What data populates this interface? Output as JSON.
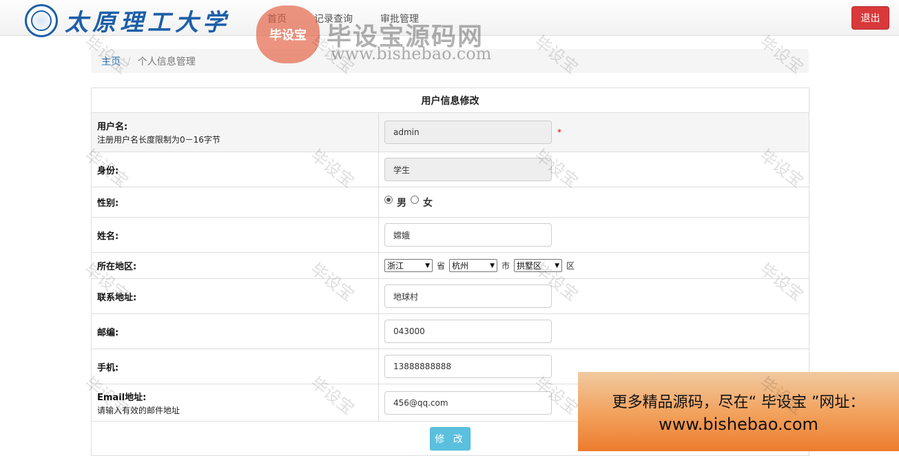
{
  "header": {
    "logo_text": "太原理工大学",
    "nav": [
      "首页",
      "记录查询",
      "审批管理"
    ],
    "logout": "退出"
  },
  "breadcrumb": {
    "home": "主页",
    "current": "个人信息管理"
  },
  "form": {
    "title": "用户信息修改",
    "username": {
      "label": "用户名:",
      "hint": "注册用户名长度限制为0－16字节",
      "value": "admin",
      "required": "*"
    },
    "identity": {
      "label": "身份:",
      "value": "学生"
    },
    "gender": {
      "label": "性别:",
      "options": [
        "男",
        "女"
      ],
      "selected": "男"
    },
    "name": {
      "label": "姓名:",
      "value": "嫦娥"
    },
    "region": {
      "label": "所在地区:",
      "province": "浙江",
      "province_unit": "省",
      "city": "杭州",
      "city_unit": "市",
      "district": "拱墅区",
      "district_unit": "区"
    },
    "address": {
      "label": "联系地址:",
      "value": "地球村"
    },
    "zip": {
      "label": "邮编:",
      "value": "043000"
    },
    "phone": {
      "label": "手机:",
      "value": "13888888888"
    },
    "email": {
      "label": "Email地址:",
      "hint": "请输入有效的邮件地址",
      "value": "456@qq.com"
    },
    "submit": "修 改"
  },
  "watermark": {
    "text": "毕设宝",
    "brand": "毕设宝源码网",
    "url": "www.bishebao.com"
  },
  "promo": {
    "line1": "更多精品源码，尽在“ 毕设宝 ”网址：",
    "line2": "www.bishebao.com"
  },
  "colors": {
    "logout": "#d9393a",
    "submit": "#5bc0de",
    "link": "#337ab7"
  }
}
